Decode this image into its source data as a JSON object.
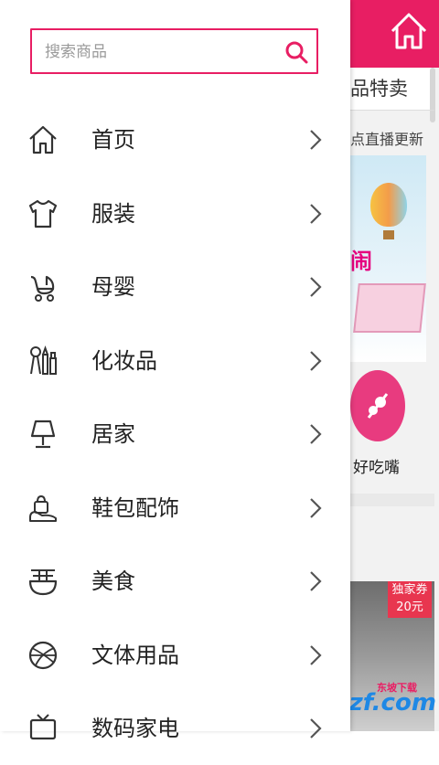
{
  "search": {
    "placeholder": "搜索商品"
  },
  "menu": [
    {
      "label": "首页",
      "icon": "home-icon"
    },
    {
      "label": "服装",
      "icon": "tshirt-icon"
    },
    {
      "label": "母婴",
      "icon": "stroller-icon"
    },
    {
      "label": "化妆品",
      "icon": "cosmetics-icon"
    },
    {
      "label": "居家",
      "icon": "lamp-icon"
    },
    {
      "label": "鞋包配饰",
      "icon": "shoe-bag-icon"
    },
    {
      "label": "美食",
      "icon": "noodle-bowl-icon"
    },
    {
      "label": "文体用品",
      "icon": "basketball-icon"
    },
    {
      "label": "数码家电",
      "icon": "tv-icon"
    }
  ],
  "background": {
    "section_title": "品特卖",
    "subtitle": "点直播更新",
    "circle_label": "好吃嘴",
    "tag_line1": "独家券",
    "tag_line2": "20元",
    "banner_text": "闹"
  },
  "watermark": {
    "text": "uzzf.com",
    "small": "东坡下载"
  },
  "colors": {
    "accent": "#e81e63",
    "icon": "#333333",
    "text": "#222222",
    "chevron": "#555555"
  }
}
